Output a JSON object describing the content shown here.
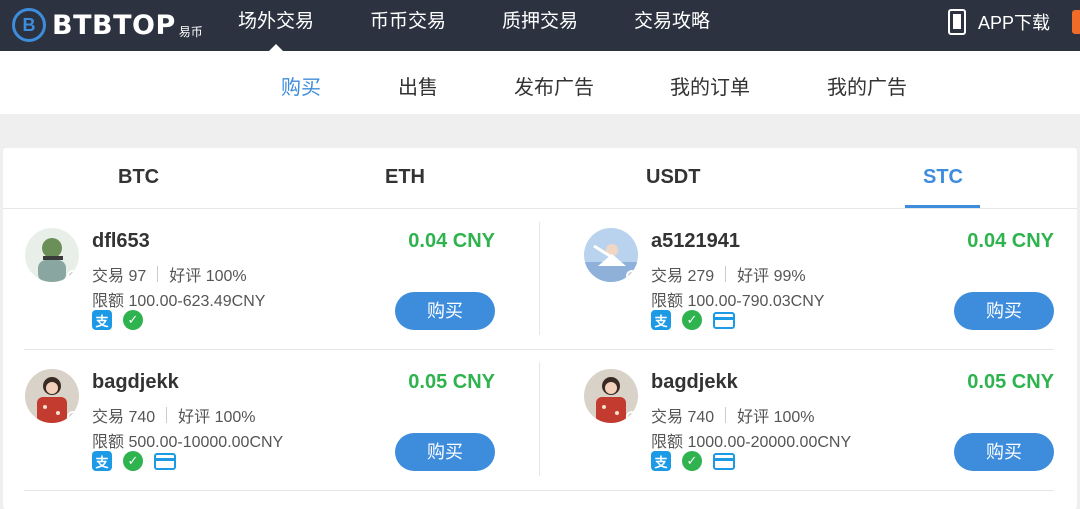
{
  "brand": {
    "logo_letter": "B",
    "name": "BTBTOP",
    "sub": "易币"
  },
  "topnav": [
    "场外交易",
    "币币交易",
    "质押交易",
    "交易攻略"
  ],
  "app_download": "APP下载",
  "subnav": [
    "购买",
    "出售",
    "发布广告",
    "我的订单",
    "我的广告"
  ],
  "coins": [
    "BTC",
    "ETH",
    "USDT",
    "STC"
  ],
  "offers": [
    {
      "name": "dfl653",
      "price": "0.04 CNY",
      "trades_label": "交易 97",
      "rating_label": "好评 100%",
      "limit": "限额 100.00-623.49CNY",
      "button": "购买",
      "avatar_color": "#7fa38c"
    },
    {
      "name": "a5121941",
      "price": "0.04 CNY",
      "trades_label": "交易 279",
      "rating_label": "好评 99%",
      "limit": "限额 100.00-790.03CNY",
      "button": "购买",
      "avatar_color": "#7aa4d6"
    },
    {
      "name": "bagdjekk",
      "price": "0.05 CNY",
      "trades_label": "交易 740",
      "rating_label": "好评 100%",
      "limit": "限额 500.00-10000.00CNY",
      "button": "购买",
      "avatar_color": "#c23b2e"
    },
    {
      "name": "bagdjekk",
      "price": "0.05 CNY",
      "trades_label": "交易 740",
      "rating_label": "好评 100%",
      "limit": "限额 1000.00-20000.00CNY",
      "button": "购买",
      "avatar_color": "#c23b2e"
    }
  ],
  "payment_icons": {
    "alipay": "支",
    "wechat": "✓"
  },
  "colors": {
    "accent": "#3d8ddc",
    "price_green": "#2fb34f",
    "topbar": "#2c3240"
  }
}
